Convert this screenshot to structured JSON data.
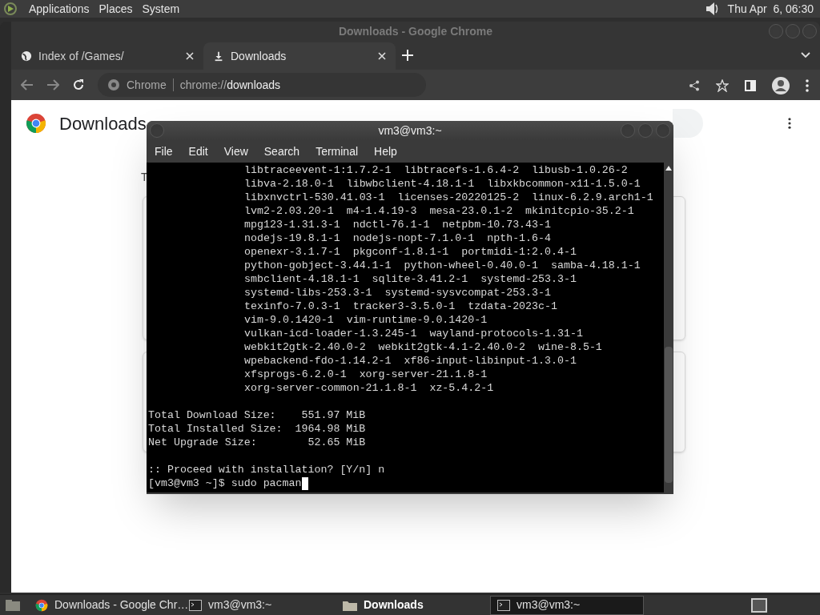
{
  "top_panel": {
    "menus": [
      "Applications",
      "Places",
      "System"
    ],
    "clock": "Thu Apr  6, 06:30"
  },
  "chrome": {
    "title": "Downloads - Google Chrome",
    "tabs": [
      {
        "label": "Index of /Games/",
        "kind": "globe",
        "selected": false
      },
      {
        "label": "Downloads",
        "kind": "download",
        "selected": true
      }
    ],
    "omnibox": {
      "site": "Chrome",
      "scheme": "chrome://",
      "path": "downloads"
    },
    "page": {
      "heading": "Downloads",
      "fragment": "T"
    }
  },
  "terminal": {
    "title": "vm3@vm3:~",
    "menus": [
      "File",
      "Edit",
      "View",
      "Search",
      "Terminal",
      "Help"
    ],
    "packages": [
      "libtraceevent-1:1.7.2-1  libtracefs-1.6.4-2  libusb-1.0.26-2",
      "libva-2.18.0-1  libwbclient-4.18.1-1  libxkbcommon-x11-1.5.0-1",
      "libxnvctrl-530.41.03-1  licenses-20220125-2  linux-6.2.9.arch1-1",
      "lvm2-2.03.20-1  m4-1.4.19-3  mesa-23.0.1-2  mkinitcpio-35.2-1",
      "mpg123-1.31.3-1  ndctl-76.1-1  netpbm-10.73.43-1",
      "nodejs-19.8.1-1  nodejs-nopt-7.1.0-1  npth-1.6-4",
      "openexr-3.1.7-1  pkgconf-1.8.1-1  portmidi-1:2.0.4-1",
      "python-gobject-3.44.1-1  python-wheel-0.40.0-1  samba-4.18.1-1",
      "smbclient-4.18.1-1  sqlite-3.41.2-1  systemd-253.3-1",
      "systemd-libs-253.3-1  systemd-sysvcompat-253.3-1",
      "texinfo-7.0.3-1  tracker3-3.5.0-1  tzdata-2023c-1",
      "vim-9.0.1420-1  vim-runtime-9.0.1420-1",
      "vulkan-icd-loader-1.3.245-1  wayland-protocols-1.31-1",
      "webkit2gtk-2.40.0-2  webkit2gtk-4.1-2.40.0-2  wine-8.5-1",
      "wpebackend-fdo-1.14.2-1  xf86-input-libinput-1.3.0-1",
      "xfsprogs-6.2.0-1  xorg-server-21.1.8-1",
      "xorg-server-common-21.1.8-1  xz-5.4.2-1"
    ],
    "summary": [
      "Total Download Size:    551.97 MiB",
      "Total Installed Size:  1964.98 MiB",
      "Net Upgrade Size:        52.65 MiB"
    ],
    "question": ":: Proceed with installation? [Y/n] n",
    "prompt": "[vm3@vm3 ~]$ sudo pacman"
  },
  "taskbar": [
    {
      "label": "Downloads - Google Chr…",
      "kind": "chrome",
      "selected": false,
      "urgent": false
    },
    {
      "label": "vm3@vm3:~",
      "kind": "terminal",
      "selected": false,
      "urgent": false
    },
    {
      "label": "Downloads",
      "kind": "folder",
      "selected": false,
      "urgent": true
    },
    {
      "label": "vm3@vm3:~",
      "kind": "terminal",
      "selected": true,
      "urgent": false
    }
  ]
}
